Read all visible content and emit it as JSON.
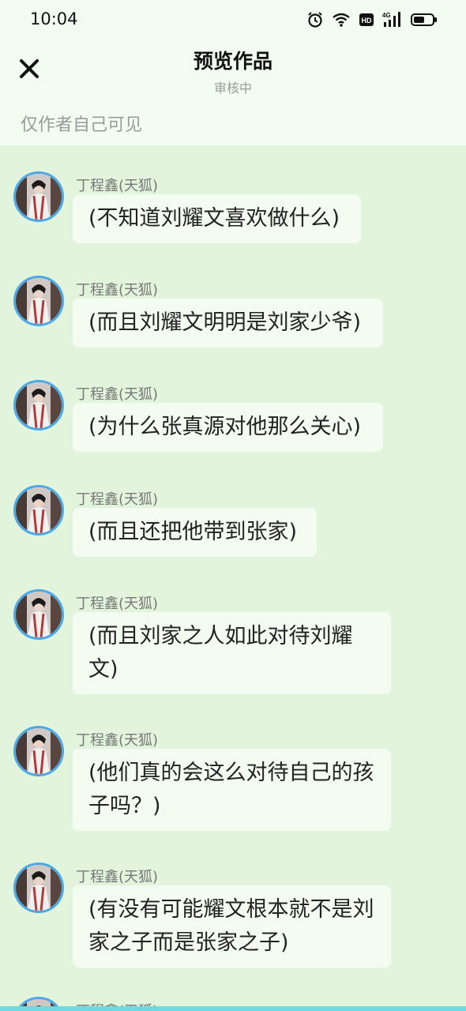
{
  "status_bar": {
    "time": "10:04",
    "icons": [
      "alarm-icon",
      "wifi-icon",
      "hd-icon",
      "4g-signal-icon",
      "battery-icon"
    ],
    "network_label": "4G"
  },
  "header": {
    "title": "预览作品",
    "status": "审核中",
    "close_icon": "close-icon"
  },
  "visibility_note": "仅作者自己可见",
  "messages": [
    {
      "name": "丁程鑫(天狐)",
      "text": "(不知道刘耀文喜欢做什么)"
    },
    {
      "name": "丁程鑫(天狐)",
      "text": "(而且刘耀文明明是刘家少爷)"
    },
    {
      "name": "丁程鑫(天狐)",
      "text": "(为什么张真源对他那么关心)"
    },
    {
      "name": "丁程鑫(天狐)",
      "text": "(而且还把他带到张家)"
    },
    {
      "name": "丁程鑫(天狐)",
      "text": "(而且刘家之人如此对待刘耀文)"
    },
    {
      "name": "丁程鑫(天狐)",
      "text": "(他们真的会这么对待自己的孩子吗？)"
    },
    {
      "name": "丁程鑫(天狐)",
      "text": "(有没有可能耀文根本就不是刘家之子而是张家之子)"
    },
    {
      "name": "丁程鑫(天狐)",
      "text": ""
    }
  ],
  "colors": {
    "background": "#e3f4dc",
    "header_background": "#f2fcf0",
    "bubble": "#f4fcf2",
    "avatar_ring": "#4aa9e6",
    "bottom_strip": "#6ed9e0"
  }
}
